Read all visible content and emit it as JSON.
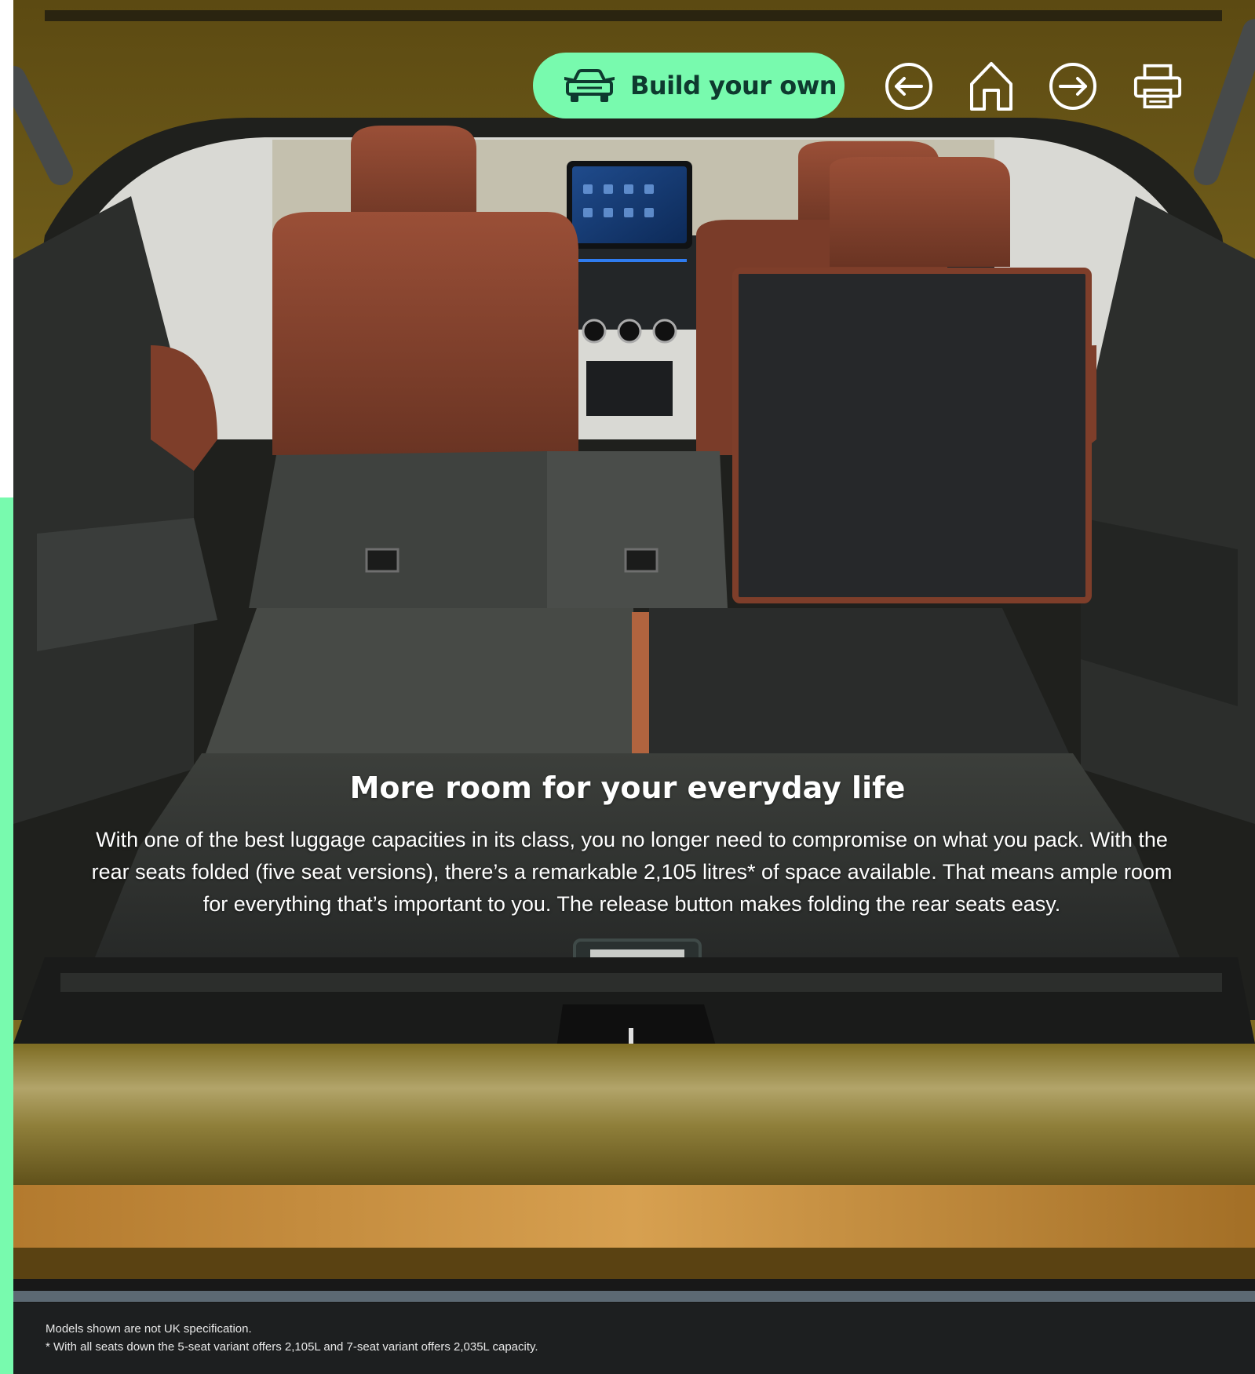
{
  "toolbar": {
    "build_label": "Build your own",
    "build_icon": "car-front-icon",
    "back_icon": "arrow-left-circle-icon",
    "home_icon": "home-icon",
    "forward_icon": "arrow-right-circle-icon",
    "print_icon": "printer-icon"
  },
  "content": {
    "headline": "More room for your everyday life",
    "paragraph": "With one of the best luggage capacities in its class, you no longer need to compromise on what you pack. With the rear seats folded (five seat versions), there’s a remarkable 2,105 litres* of space available. That means ample room for everything that’s important to you. The release button makes folding the rear seats easy."
  },
  "footnotes": {
    "disclaimer": "Models shown are not UK specification.",
    "capacity_note": "* With all seats down the 5-seat variant offers 2,105L and 7-seat variant offers 2,035L capacity."
  },
  "colors": {
    "accent": "#78faae",
    "accent_text": "#0e3a2f",
    "body_paint": "#8a7320",
    "carpet": "#2b2d2c",
    "leather": "#8a4632"
  }
}
